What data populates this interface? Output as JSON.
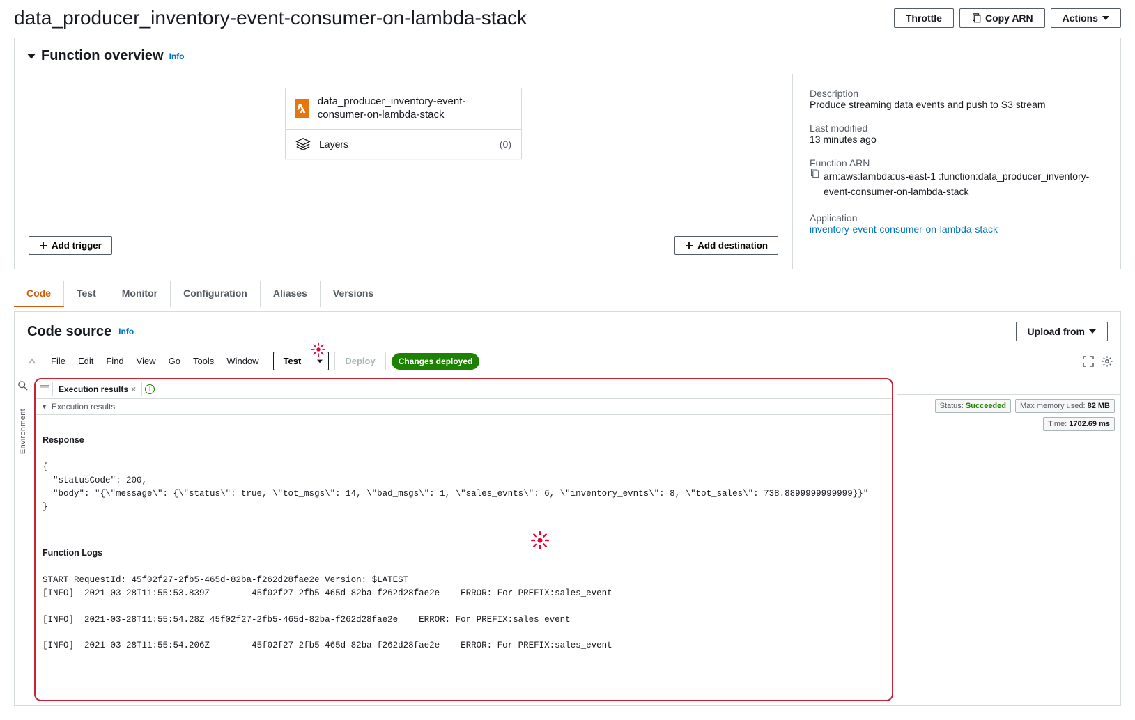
{
  "header": {
    "title": "data_producer_inventory-event-consumer-on-lambda-stack",
    "throttle": "Throttle",
    "copy_arn": "Copy ARN",
    "actions": "Actions"
  },
  "overview": {
    "heading": "Function overview",
    "info": "Info",
    "function_name": "data_producer_inventory-event-consumer-on-lambda-stack",
    "layers_label": "Layers",
    "layers_count": "(0)",
    "add_trigger": "Add trigger",
    "add_destination": "Add destination"
  },
  "meta": {
    "description_label": "Description",
    "description_value": "Produce streaming data events and push to S3 stream",
    "last_modified_label": "Last modified",
    "last_modified_value": "13 minutes ago",
    "arn_label": "Function ARN",
    "arn_value": "arn:aws:lambda:us-east-1                     :function:data_producer_inventory-event-consumer-on-lambda-stack",
    "application_label": "Application",
    "application_value": "inventory-event-consumer-on-lambda-stack"
  },
  "tabs": {
    "code": "Code",
    "test": "Test",
    "monitor": "Monitor",
    "configuration": "Configuration",
    "aliases": "Aliases",
    "versions": "Versions"
  },
  "code_source": {
    "heading": "Code source",
    "info": "Info",
    "upload_from": "Upload from"
  },
  "ide": {
    "menu": {
      "file": "File",
      "edit": "Edit",
      "find": "Find",
      "view": "View",
      "go": "Go",
      "tools": "Tools",
      "window": "Window"
    },
    "test": "Test",
    "deploy": "Deploy",
    "deployed_badge": "Changes deployed",
    "side_env": "Environment",
    "tab_label": "Execution results",
    "results_header": "Execution results",
    "response_label": "Response",
    "function_logs_label": "Function Logs",
    "status_label": "Status: ",
    "status_value": "Succeeded",
    "mem_prefix": "Max memory used: ",
    "mem_value": "82 MB",
    "time_prefix": "Time: ",
    "time_value": "1702.69 ms",
    "response_body": "{\n  \"statusCode\": 200,\n  \"body\": \"{\\\"message\\\": {\\\"status\\\": true, \\\"tot_msgs\\\": 14, \\\"bad_msgs\\\": 1, \\\"sales_evnts\\\": 6, \\\"inventory_evnts\\\": 8, \\\"tot_sales\\\": 738.8899999999999}}\"\n}",
    "logs_body": "START RequestId: 45f02f27-2fb5-465d-82ba-f262d28fae2e Version: $LATEST\n[INFO]\t2021-03-28T11:55:53.839Z\t45f02f27-2fb5-465d-82ba-f262d28fae2e\tERROR: For PREFIX:sales_event\n\n[INFO]\t2021-03-28T11:55:54.28Z\t45f02f27-2fb5-465d-82ba-f262d28fae2e\tERROR: For PREFIX:sales_event\n\n[INFO]\t2021-03-28T11:55:54.206Z\t45f02f27-2fb5-465d-82ba-f262d28fae2e\tERROR: For PREFIX:sales_event"
  }
}
